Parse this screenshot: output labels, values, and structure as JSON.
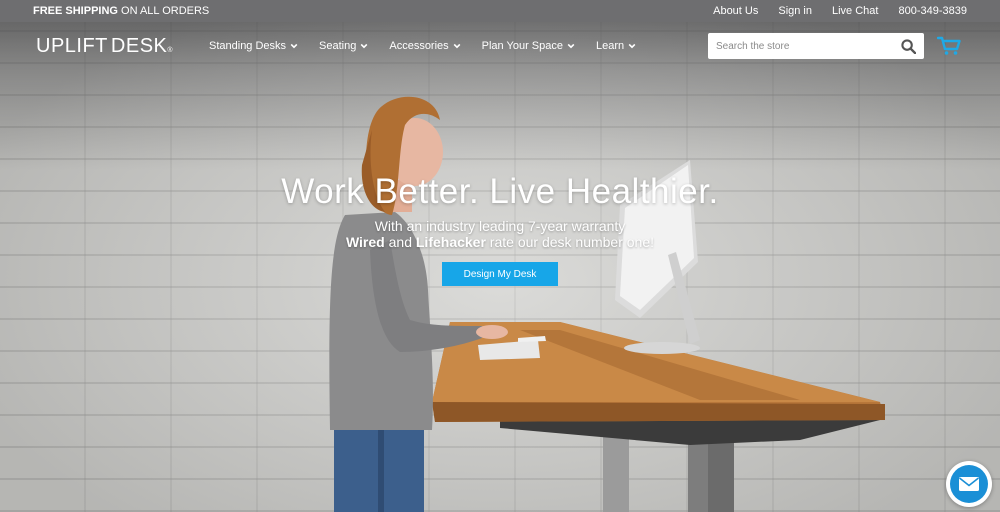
{
  "topbar": {
    "promo_bold": "FREE SHIPPING",
    "promo_rest": " ON ALL ORDERS",
    "links": [
      "About Us",
      "Sign in",
      "Live Chat",
      "800-349-3839"
    ]
  },
  "brand": {
    "part1": "UPLIFT",
    "part2": "DESK",
    "reg": "®"
  },
  "nav": {
    "items": [
      "Standing Desks",
      "Seating",
      "Accessories",
      "Plan Your Space",
      "Learn"
    ]
  },
  "search": {
    "placeholder": "Search the store",
    "value": ""
  },
  "hero": {
    "headline": "Work Better. Live Healthier.",
    "sub1": "With an industry leading 7-year warranty",
    "sub2_bold1": "Wired",
    "sub2_mid": " and ",
    "sub2_bold2": "Lifehacker",
    "sub2_rest": " rate our desk number one!",
    "cta": "Design My Desk"
  },
  "colors": {
    "accent": "#17a6e8",
    "chat": "#1a8fd6",
    "cart": "#1fa9e6"
  },
  "icons": {
    "search": "magnifier",
    "cart": "shopping-cart",
    "chat": "envelope",
    "chevron": "chevron-down"
  }
}
